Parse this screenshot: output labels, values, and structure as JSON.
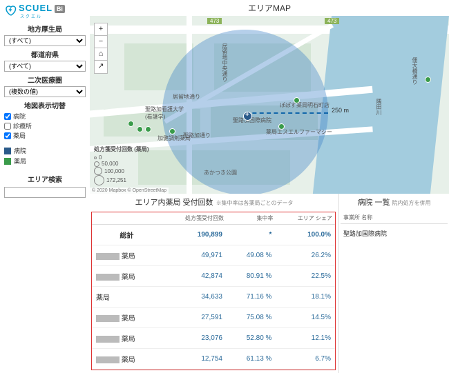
{
  "app": {
    "name": "SCUEL",
    "sub": "スクエル",
    "badge": "Bi"
  },
  "sidebar": {
    "field1_label": "地方厚生局",
    "field1_value": "(すべて)",
    "field2_label": "都道府県",
    "field2_value": "(すべて)",
    "field3_label": "二次医療圏",
    "field3_value": "(複数の値)",
    "dispswitch_label": "地図表示切替",
    "checks": [
      {
        "label": "病院",
        "checked": true
      },
      {
        "label": "診療所",
        "checked": false
      },
      {
        "label": "薬局",
        "checked": true
      }
    ],
    "legend_hospital": "病院",
    "legend_pharmacy": "薬局",
    "search_label": "エリア検索"
  },
  "map": {
    "title": "エリアMAP",
    "radius_label": "250 m",
    "labels": {
      "r473": "473",
      "kyoryu": "居留地通り",
      "kyoryu2": "居留地中央通り",
      "stluke": "聖路加通り",
      "univ": "聖路加看護大学\n(看護学)",
      "hospital": "聖路加国際病院",
      "popo": "ぽぽず薬局明石町店",
      "esuel": "薬局エスエルファーマシー",
      "kabi": "加健調剤薬局",
      "akatsuki": "あかつき公園",
      "sumida": "隅田川",
      "tsukuda": "佃大橋通り"
    },
    "bubble_legend_title": "処方箋受付回数 (薬局)",
    "bubble_legend": [
      "0",
      "50,000",
      "100,000",
      "172,251"
    ],
    "attribution": "© 2020 Mapbox © OpenStreetMap",
    "zoom_in": "+",
    "zoom_out": "−",
    "home": "⌂",
    "arrow": "↗"
  },
  "table": {
    "title": "エリア内薬局 受付回数",
    "subtitle": "※集中率は各薬局ごとのデータ",
    "headers": [
      "",
      "処方箋受付回数",
      "集中率",
      "エリア シェア"
    ],
    "total_row": {
      "label": "総計",
      "count": "190,899",
      "rate": "*",
      "share": "100.0%"
    },
    "rows": [
      {
        "label": "薬局",
        "count": "49,971",
        "rate": "49.08 %",
        "share": "26.2%"
      },
      {
        "label": "薬局",
        "count": "42,874",
        "rate": "80.91 %",
        "share": "22.5%"
      },
      {
        "label": "薬局",
        "count": "34,633",
        "rate": "71.16 %",
        "share": "18.1%"
      },
      {
        "label": "薬局",
        "count": "27,591",
        "rate": "75.08 %",
        "share": "14.5%"
      },
      {
        "label": "薬局",
        "count": "23,076",
        "rate": "52.80 %",
        "share": "12.1%"
      },
      {
        "label": "薬局",
        "count": "12,754",
        "rate": "61.13 %",
        "share": "6.7%"
      }
    ]
  },
  "hospital_panel": {
    "title": "病院 一覧",
    "subtitle": "院内処方を併用",
    "header": "事業所 名称",
    "rows": [
      "聖路加国際病院"
    ]
  }
}
